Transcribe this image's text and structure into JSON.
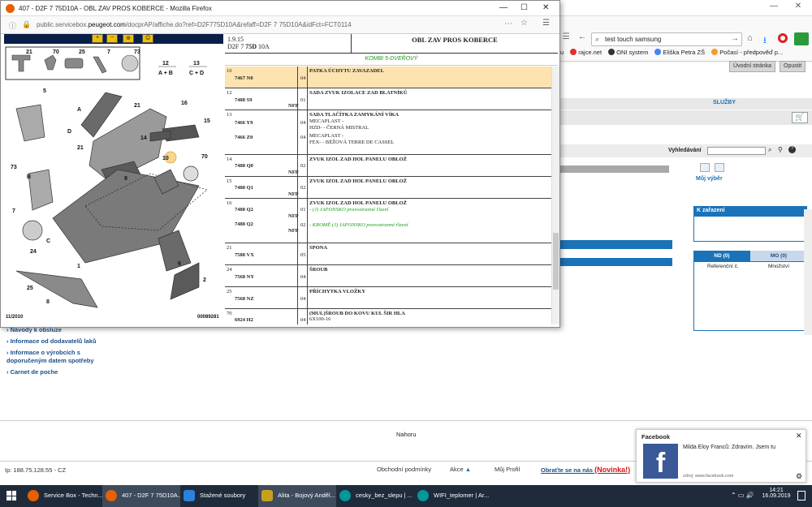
{
  "background_browser": {
    "search_value": "test touch samsung",
    "bookmarks": [
      "rajce.net",
      "ONI system",
      "Eliška Petra ZŠ",
      "Počasí - předpověď p..."
    ],
    "bookmark_partial": "u",
    "buttons": {
      "home": "Úvodní stránka",
      "logout": "Opustit"
    },
    "sluzby": "SLUŽBY",
    "vyhledavani_label": "Vyhledávání",
    "muj_vyber": "Můj výběr",
    "k_zarazeni": "K zařazení",
    "tabs": {
      "nd": "ND (0)",
      "mo": "MO (0)"
    },
    "columns": {
      "ref": "Referenční č.",
      "qty": "Množství"
    },
    "left_links": [
      "Návody k obsluze",
      "Informace od dodavatelů laků",
      "Informace o výrobcích s doporučeným datem spotřeby",
      "Carnet de poche"
    ],
    "nahoru": "Nahoru",
    "footer": {
      "ip": "Ip: 188.75.128.55 - CZ",
      "obchodni": "Obchodní podmínky",
      "akce": "Akce",
      "muj_profil": "Můj Profil",
      "obratte": "Obraťte se na nás",
      "novinka": "(Novinka!)"
    }
  },
  "popup": {
    "title": "407 - D2F 7 75D10A - OBL ZAV PROS KOBERCE - Mozilla Firefox",
    "url_prefix": "public.servicebox.",
    "url_domain": "peugeot.com",
    "url_rest": "/docprAP/affiche.do?ref=D2F775D10A&refaff=D2F 7 75D10A&idFct=FCT0114",
    "diagram": {
      "date": "11/2010",
      "code": "00089281",
      "top_parts": [
        "21",
        "70",
        "25",
        "7",
        "73"
      ],
      "group_labels": [
        {
          "n": "12",
          "s": "A + B"
        },
        {
          "n": "13",
          "s": "C + D"
        }
      ],
      "callouts": [
        "5",
        "A",
        "21",
        "16",
        "D",
        "15",
        "14",
        "21",
        "73",
        "B",
        "10",
        "70",
        "7",
        "9",
        "C",
        "24",
        "1",
        "25",
        "8",
        "6",
        "2"
      ]
    },
    "header": {
      "version": "1.9.15",
      "code_prefix": "D2F 7",
      "code_bold": "75D",
      "code_suffix": "10A",
      "title": "OBL ZAV PROS KOBERCE",
      "variant": "KOMBI 5-DVEŘOVÝ"
    },
    "rows": [
      {
        "pos": "10",
        "refs": [
          {
            "r": "7467 N0",
            "nfp": "",
            "qty": "04"
          }
        ],
        "desc": "PATKA ÚCHYTU ZAVAZADEL",
        "sub": [],
        "highlight": true
      },
      {
        "pos": "12",
        "refs": [
          {
            "r": "7488 S9",
            "nfp": "NFP",
            "qty": "01"
          }
        ],
        "desc": "SADA ZVUK IZOLACE ZAD BLATNÍKŮ",
        "sub": []
      },
      {
        "pos": "13",
        "refs": [
          {
            "r": "7466 Y9",
            "nfp": "",
            "qty": "04"
          },
          {
            "r": "7466 Z0",
            "nfp": "",
            "qty": "04"
          }
        ],
        "desc": "SADA TLAČÍTKA ZAMYKÁNÍ VÍKA",
        "sub": [
          "MECAPLAST -",
          "HZD- - ČERNÁ MISTRAL",
          "MECAPLAST -",
          "FEX- - BÉŽOVÁ TERRE DE CASSEL"
        ]
      },
      {
        "pos": "14",
        "refs": [
          {
            "r": "7488 Q0",
            "nfp": "NFP",
            "qty": "02"
          }
        ],
        "desc": "ZVUK IZOL ZAD HOL PANELU OBLOŽ",
        "sub": []
      },
      {
        "pos": "15",
        "refs": [
          {
            "r": "7488 Q1",
            "nfp": "NFP",
            "qty": "02"
          }
        ],
        "desc": "ZVUK IZOL ZAD HOL PANELU OBLOŽ",
        "sub": []
      },
      {
        "pos": "16",
        "refs": [
          {
            "r": "7488 Q2",
            "nfp": "NFP",
            "qty": "01"
          },
          {
            "r": "7488 Q2",
            "nfp": "NFP",
            "qty": "02"
          }
        ],
        "desc": "ZVUK IZOL ZAD HOL PANELU OBLOŽ",
        "sub": [
          "- (J) JAPONSKO pravostranné řízení",
          "- KROMĚ (J) JAPONSKO pravostranné řízení"
        ]
      },
      {
        "pos": "21",
        "refs": [
          {
            "r": "7588 VX",
            "nfp": "",
            "qty": "05"
          }
        ],
        "desc": "SPONA",
        "sub": []
      },
      {
        "pos": "24",
        "refs": [
          {
            "r": "7568 NY",
            "nfp": "",
            "qty": "04"
          }
        ],
        "desc": "ŠROUB",
        "sub": []
      },
      {
        "pos": "25",
        "refs": [
          {
            "r": "7568 NZ",
            "nfp": "",
            "qty": "04"
          }
        ],
        "desc": "PŘÍCHYTKA VLOŽKY",
        "sub": []
      },
      {
        "pos": "70",
        "refs": [
          {
            "r": "6924 H2",
            "nfp": "",
            "qty": "04"
          }
        ],
        "desc": "(MUL)ŠROUB DO KOVU KUL ŠIR HLA",
        "sub": [
          "6X100-16"
        ]
      }
    ]
  },
  "notification": {
    "source": "Facebook",
    "message": "Milda Eloy Franců: Zdravím. Jsem tu",
    "site": "zdroj: www.facebook.com"
  },
  "taskbar": {
    "items": [
      "Service Box - Techn...",
      "407 - D2F 7 75D10A...",
      "Stažené soubory",
      "Alita - Bojový Anděl...",
      "cesky_bez_slepu | ...",
      "WIFI_teplomer | Ar..."
    ],
    "time": "14:21",
    "date": "16.09.2019"
  },
  "colors": {
    "accent": "#1a73b8",
    "highlight_row": "#fde3b0",
    "green": "#1a9a1a",
    "taskbar": "#1f2b3a"
  }
}
